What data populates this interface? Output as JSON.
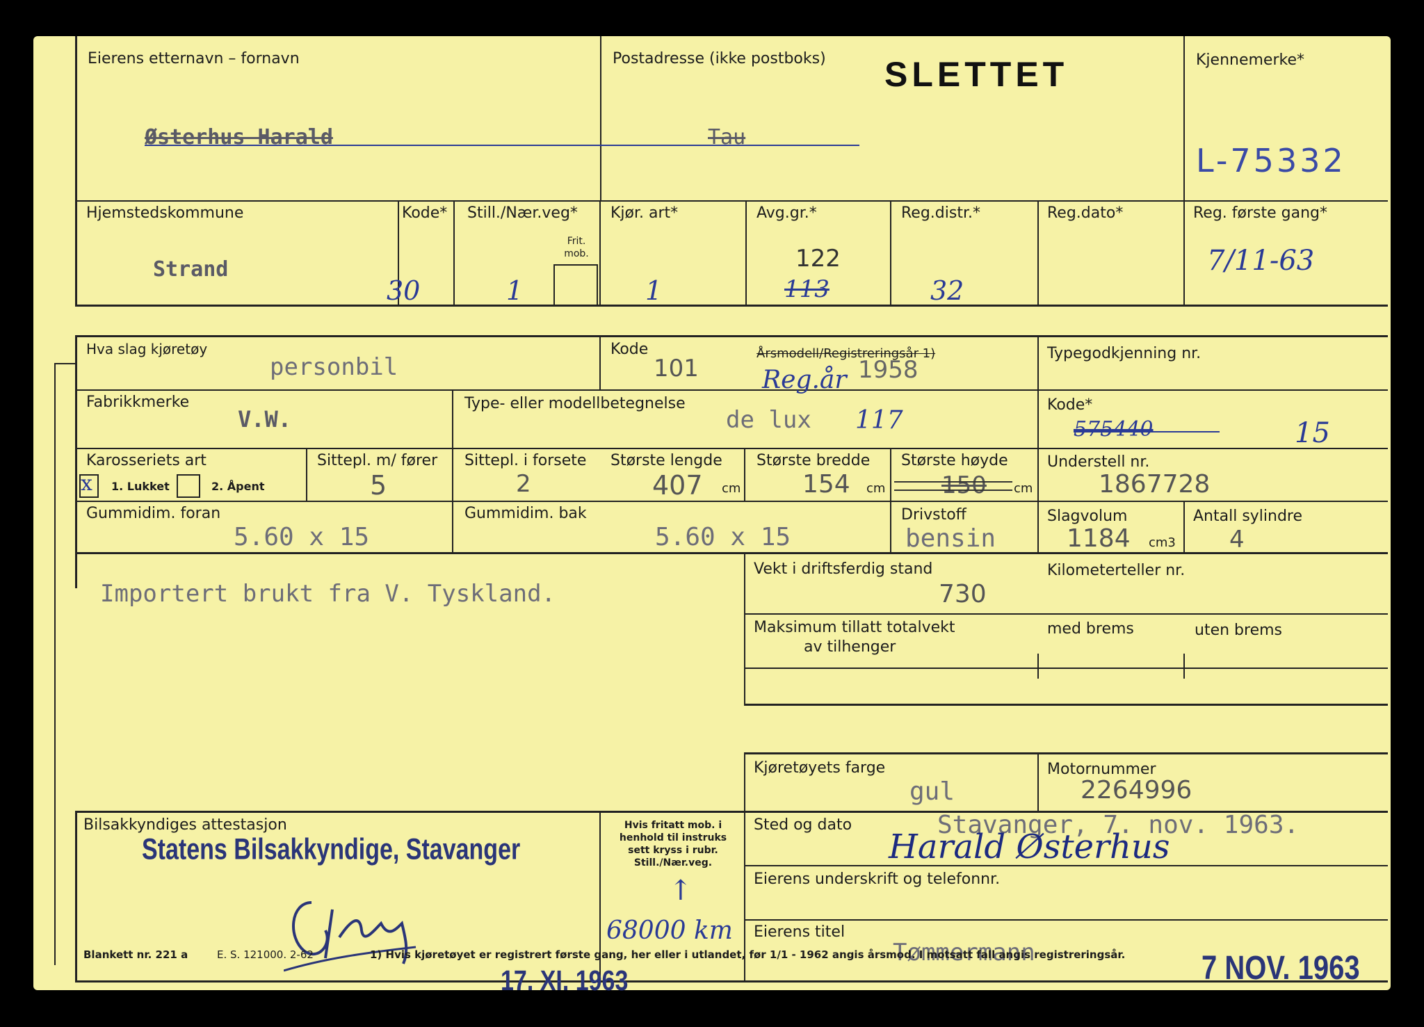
{
  "header": {
    "owner_label": "Eierens etternavn – fornavn",
    "owner_value": "Østerhus Harald",
    "address_label": "Postadresse (ikke postboks)",
    "address_value": "Tau",
    "status_stamp": "SLETTET",
    "plate_label": "Kjennemerke*",
    "plate_value": "L-75332"
  },
  "registration": {
    "municipality_label": "Hjemstedskommune",
    "municipality_value": "Strand",
    "code_label": "Kode*",
    "code_value": "30",
    "still_label": "Still./Nær.veg*",
    "still_value": "1",
    "frit_label": "Frit. mob.",
    "kjor_label": "Kjør. art*",
    "kjor_value": "1",
    "avg_label": "Avg.gr.*",
    "avg_value": "122",
    "avg_old": "113",
    "regdistr_label": "Reg.distr.*",
    "regdistr_value": "32",
    "regdato_label": "Reg.dato*",
    "first_reg_label": "Reg. første gang*",
    "first_reg_value": "7/11-63"
  },
  "vehicle": {
    "kind_label": "Hva slag kjøretøy",
    "kind_value": "personbil",
    "kode_label": "Kode",
    "kode_value": "101",
    "year_label": "Årsmodell/Registreringsår 1)",
    "year_note": "Reg.år",
    "year_value": "1958",
    "typegod_label": "Typegodkjenning nr.",
    "make_label": "Fabrikkmerke",
    "make_value": "V.W.",
    "model_label": "Type- eller modellbetegnelse",
    "model_value": "de lux",
    "model_hand": "117",
    "kode2_label": "Kode*",
    "kode2_old": "575440",
    "kode2_value": "15",
    "body_label": "Karosseriets art",
    "body_opt1": "1. Lukket",
    "body_opt2": "2. Åpent",
    "body_mark": "x",
    "seats_label": "Sittepl. m/ fører",
    "seats_value": "5",
    "front_seats_label": "Sittepl. i forsete",
    "front_seats_value": "2",
    "length_label": "Største lengde",
    "length_value": "407",
    "width_label": "Største bredde",
    "width_value": "154",
    "height_label": "Største høyde",
    "height_value": "150",
    "cm": "cm",
    "chassis_label": "Understell nr.",
    "chassis_value": "1867728",
    "tire_front_label": "Gummidim. foran",
    "tire_front_value": "5.60 x 15",
    "tire_rear_label": "Gummidim. bak",
    "tire_rear_value": "5.60 x 15",
    "fuel_label": "Drivstoff",
    "fuel_value": "bensin",
    "volume_label": "Slagvolum",
    "volume_value": "1184",
    "volume_unit": "cm3",
    "cyl_label": "Antall sylindre",
    "cyl_value": "4",
    "note": "Importert brukt fra V. Tyskland.",
    "weight_label": "Vekt i driftsferdig stand",
    "weight_value": "730",
    "odo_label": "Kilometerteller nr.",
    "trailer_label": "Maksimum tillatt totalvekt",
    "trailer_label2": "av tilhenger",
    "with_brake_label": "med brems",
    "without_brake_label": "uten brems",
    "color_label": "Kjøretøyets farge",
    "color_value": "gul",
    "engine_label": "Motornummer",
    "engine_value": "2264996"
  },
  "attest": {
    "label": "Bilsakkyndiges attestasjon",
    "stamp": "Statens Bilsakkyndige, Stavanger",
    "frit_note": "Hvis fritatt mob. i henhold til instruks sett kryss i rubr. Still./Nær.veg.",
    "km": "68000 km",
    "place_label": "Sted og dato",
    "place_value": "Stavanger, 7. nov. 1963.",
    "signature": "Harald Østerhus",
    "sign_label": "Eierens underskrift og telefonnr.",
    "title_label": "Eierens titel",
    "title_value": "Tømmermann"
  },
  "footer": {
    "form": "Blankett nr. 221 a",
    "es": "E. S. 121000. 2-62",
    "footnote": "1) Hvis kjøretøyet er registrert første gang, her eller i utlandet, før 1/1 - 1962 angis årsmod. I motsatt fall angis registreringsår.",
    "stamp_left": "17. XI. 1963",
    "stamp_right": "7 NOV. 1963"
  }
}
